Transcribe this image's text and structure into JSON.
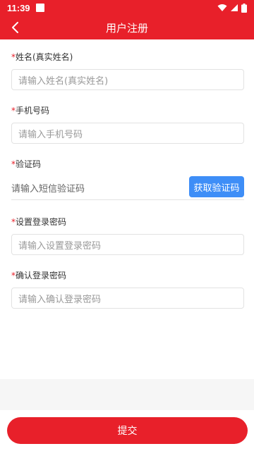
{
  "status_bar": {
    "time": "11:39"
  },
  "header": {
    "title": "用户注册"
  },
  "form": {
    "name": {
      "required_mark": "*",
      "label": "姓名(真实姓名)",
      "placeholder": "请输入姓名(真实姓名)"
    },
    "phone": {
      "required_mark": "*",
      "label": "手机号码",
      "placeholder": "请输入手机号码"
    },
    "code": {
      "required_mark": "*",
      "label": "验证码",
      "placeholder": "请输入短信验证码",
      "button": "获取验证码"
    },
    "password": {
      "required_mark": "*",
      "label": "设置登录密码",
      "placeholder": "请输入设置登录密码"
    },
    "confirm": {
      "required_mark": "*",
      "label": "确认登录密码",
      "placeholder": "请输入确认登录密码"
    }
  },
  "footer": {
    "submit": "提交"
  },
  "colors": {
    "brand_red": "#e8202a",
    "button_blue": "#3e8ef7"
  },
  "icons": {
    "back": "chevron-left-icon",
    "wifi": "wifi-icon",
    "signal": "signal-icon",
    "battery": "battery-icon",
    "notification": "notification-square-icon"
  }
}
